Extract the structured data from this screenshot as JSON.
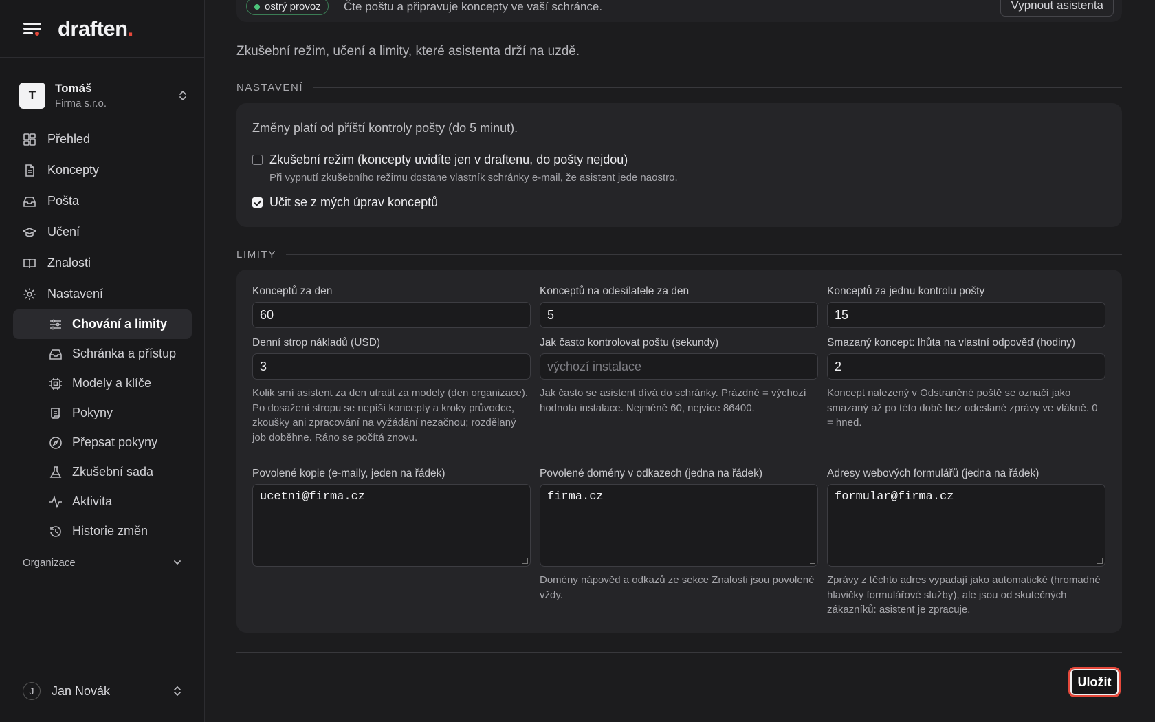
{
  "brand": {
    "name": "draften",
    "dot": "."
  },
  "account": {
    "initial": "T",
    "name": "Tomáš",
    "org": "Firma s.r.o."
  },
  "nav": [
    {
      "label": "Přehled",
      "icon": "dashboard-icon"
    },
    {
      "label": "Koncepty",
      "icon": "document-icon"
    },
    {
      "label": "Pošta",
      "icon": "inbox-icon"
    },
    {
      "label": "Učení",
      "icon": "graduation-cap-icon"
    },
    {
      "label": "Znalosti",
      "icon": "book-icon"
    },
    {
      "label": "Nastavení",
      "icon": "gear-icon"
    }
  ],
  "subnav": [
    {
      "label": "Chování a limity",
      "icon": "sliders-icon",
      "active": true
    },
    {
      "label": "Schránka a přístup",
      "icon": "inbox-icon"
    },
    {
      "label": "Modely a klíče",
      "icon": "chip-icon"
    },
    {
      "label": "Pokyny",
      "icon": "scroll-icon"
    },
    {
      "label": "Přepsat pokyny",
      "icon": "compass-icon"
    },
    {
      "label": "Zkušební sada",
      "icon": "flask-icon"
    },
    {
      "label": "Aktivita",
      "icon": "activity-icon"
    },
    {
      "label": "Historie změn",
      "icon": "history-icon"
    }
  ],
  "org_section": {
    "label": "Organizace"
  },
  "user": {
    "initial": "J",
    "name": "Jan Novák"
  },
  "topbar": {
    "badge": "ostrý provoz",
    "text": "Čte poštu a připravuje koncepty ve vaší schránce.",
    "off_button": "Vypnout asistenta"
  },
  "subtitle": "Zkušební režim, učení a limity, které asistenta drží na uzdě.",
  "settings": {
    "title": "NASTAVENÍ",
    "note": "Změny platí od příští kontroly pošty (do 5 minut).",
    "trial_mode": {
      "label": "Zkušební režim (koncepty uvidíte jen v draftenu, do pošty nejdou)",
      "hint": "Při vypnutí zkušebního režimu dostane vlastník schránky e-mail, že asistent jede naostro.",
      "checked": false
    },
    "learn": {
      "label": "Učit se z mých úprav konceptů",
      "checked": true
    }
  },
  "limits": {
    "title": "LIMITY",
    "drafts_per_day": {
      "label": "Konceptů za den",
      "value": "60"
    },
    "drafts_per_sender": {
      "label": "Konceptů na odesílatele za den",
      "value": "5"
    },
    "drafts_per_check": {
      "label": "Konceptů za jednu kontrolu pošty",
      "value": "15"
    },
    "daily_cost": {
      "label": "Denní strop nákladů (USD)",
      "value": "3",
      "help": "Kolik smí asistent za den utratit za modely (den organizace). Po dosažení stropu se nepíší koncepty a kroky průvodce, zkoušky ani zpracování na vyžádání nezačnou; rozdělaný job doběhne. Ráno se počítá znovu."
    },
    "check_interval": {
      "label": "Jak často kontrolovat poštu (sekundy)",
      "placeholder": "výchozí instalace",
      "help": "Jak často se asistent dívá do schránky. Prázdné = výchozí hodnota instalace. Nejméně 60, nejvíce 86400."
    },
    "deleted_draft": {
      "label": "Smazaný koncept: lhůta na vlastní odpověď (hodiny)",
      "value": "2",
      "help": "Koncept nalezený v Odstraněné poště se označí jako smazaný až po této době bez odeslané zprávy ve vlákně. 0 = hned."
    },
    "allowed_cc": {
      "label": "Povolené kopie (e-maily, jeden na řádek)",
      "value": "ucetni@firma.cz"
    },
    "allowed_domains": {
      "label": "Povolené domény v odkazech (jedna na řádek)",
      "value": "firma.cz",
      "help": "Domény nápověd a odkazů ze sekce Znalosti jsou povolené vždy."
    },
    "form_addresses": {
      "label": "Adresy webových formulářů (jedna na řádek)",
      "value": "formular@firma.cz",
      "help": "Zprávy z těchto adres vypadají jako automatické (hromadné hlavičky formulářové služby), ale jsou od skutečných zákazníků: asistent je zpracuje."
    }
  },
  "save_button": "Uložit",
  "colors": {
    "accent": "#e5483b",
    "live": "#4cc37a",
    "background": "#1c1c1e",
    "card": "#252528"
  }
}
